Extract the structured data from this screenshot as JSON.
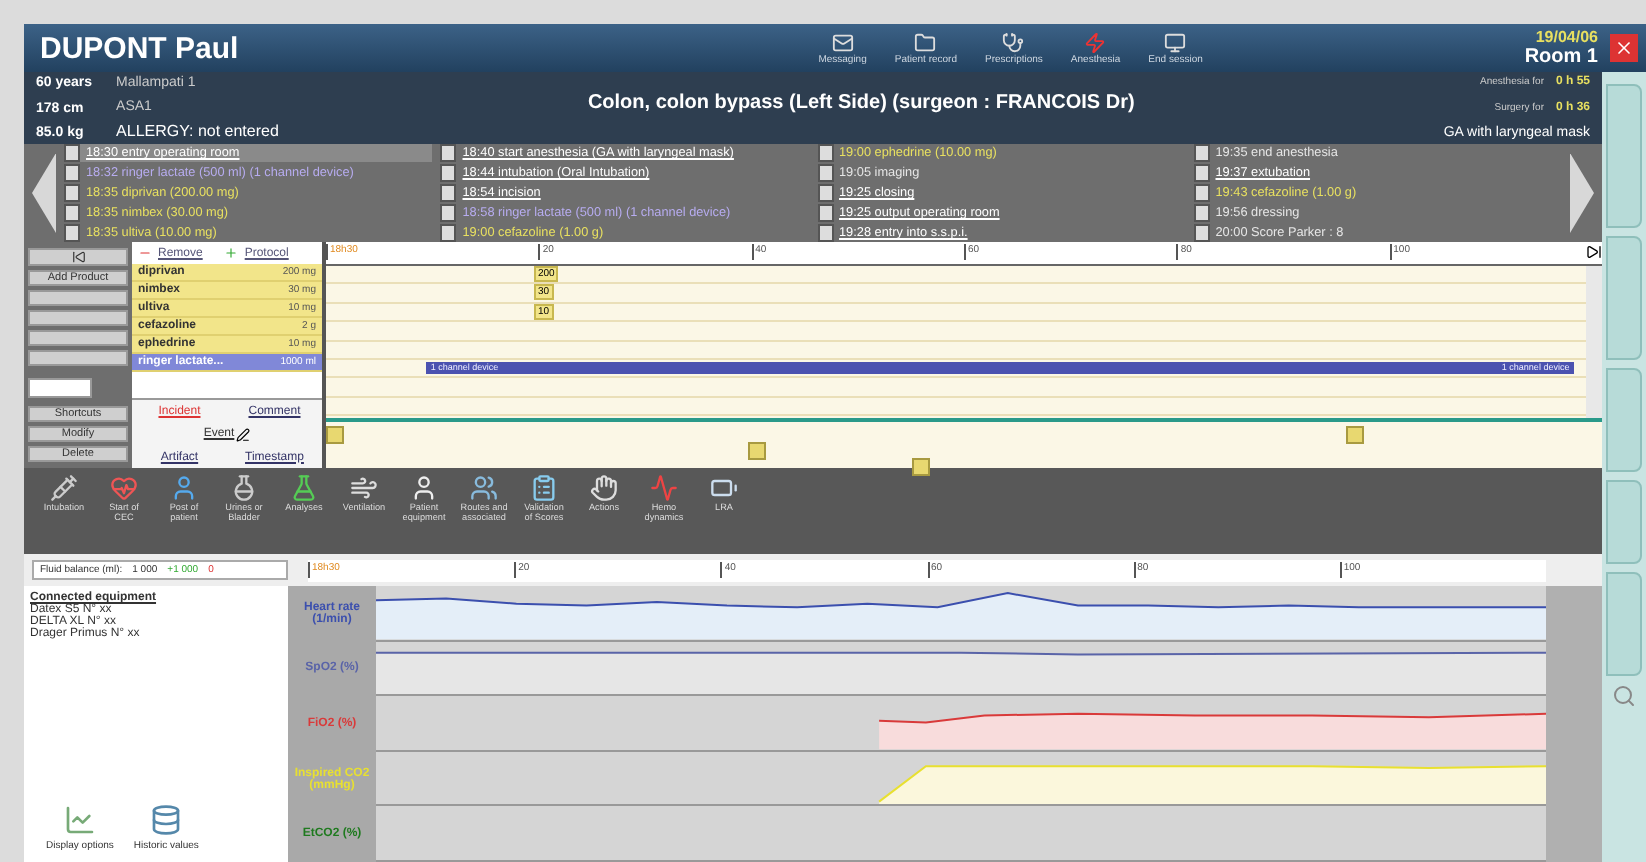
{
  "header": {
    "patient_name": "DUPONT Paul",
    "toolbar": [
      {
        "label": "Messaging"
      },
      {
        "label": "Patient record"
      },
      {
        "label": "Prescriptions"
      },
      {
        "label": "Anesthesia"
      },
      {
        "label": "End session"
      }
    ],
    "date": "19/04/06",
    "room": "Room 1"
  },
  "info": {
    "age": "60 years",
    "height": "178 cm",
    "weight": "85.0 kg",
    "mallampati": "Mallampati 1",
    "asa": "ASA1",
    "allergy": "ALLERGY: not entered",
    "procedure": "Colon, colon bypass (Left Side) (surgeon : FRANCOIS Dr)",
    "durations": [
      {
        "label": "Anesthesia for",
        "value": "0 h 55"
      },
      {
        "label": "Surgery for",
        "value": "0 h 36"
      }
    ],
    "technique": "GA with laryngeal mask"
  },
  "events": [
    [
      {
        "text": "18:30 entry operating room",
        "kind": "milestone",
        "selected": true
      },
      {
        "text": "18:32 ringer lactate (500 ml) (1 channel device)",
        "kind": "infusion",
        "selected": false
      },
      {
        "text": "18:35 diprivan (200.00 mg)",
        "kind": "drug",
        "selected": false
      },
      {
        "text": "18:35 nimbex (30.00 mg)",
        "kind": "drug",
        "selected": false
      },
      {
        "text": "18:35 ultiva (10.00 mg)",
        "kind": "drug",
        "selected": false
      }
    ],
    [
      {
        "text": "18:40 start anesthesia (GA with laryngeal mask)",
        "kind": "milestone",
        "selected": false
      },
      {
        "text": "18:44 intubation (Oral Intubation)",
        "kind": "milestone",
        "selected": false
      },
      {
        "text": "18:54 incision",
        "kind": "milestone",
        "selected": false
      },
      {
        "text": "18:58 ringer lactate (500 ml) (1 channel device)",
        "kind": "infusion",
        "selected": false
      },
      {
        "text": "19:00 cefazoline (1.00 g)",
        "kind": "drug",
        "selected": false
      }
    ],
    [
      {
        "text": "19:00 ephedrine (10.00 mg)",
        "kind": "drug",
        "selected": false
      },
      {
        "text": "19:05 imaging",
        "kind": "note",
        "selected": false
      },
      {
        "text": "19:25 closing",
        "kind": "milestone",
        "selected": false
      },
      {
        "text": "19:25 output operating room",
        "kind": "milestone",
        "selected": false
      },
      {
        "text": "19:28 entry into s.s.p.i.",
        "kind": "milestone",
        "selected": false
      }
    ],
    [
      {
        "text": "19:35 end anesthesia",
        "kind": "note",
        "selected": false
      },
      {
        "text": "19:37 extubation",
        "kind": "milestone",
        "selected": false
      },
      {
        "text": "19:43 cefazoline (1.00 g)",
        "kind": "drug",
        "selected": false
      },
      {
        "text": "19:56 dressing",
        "kind": "note",
        "selected": false
      },
      {
        "text": "20:00 Score Parker : 8",
        "kind": "note",
        "selected": false
      }
    ]
  ],
  "side_buttons": {
    "add": "Add Product",
    "bottom": [
      "Shortcuts",
      "Modify",
      "Delete"
    ]
  },
  "drug_list": {
    "remove": "Remove",
    "protocol": "Protocol",
    "drugs": [
      {
        "name": "diprivan",
        "dose": "200 mg",
        "kind": "bolus",
        "mark": "200",
        "selected": false
      },
      {
        "name": "nimbex",
        "dose": "30 mg",
        "kind": "bolus",
        "mark": "30",
        "selected": false
      },
      {
        "name": "ultiva",
        "dose": "10 mg",
        "kind": "bolus",
        "mark": "10",
        "selected": false
      },
      {
        "name": "cefazoline",
        "dose": "2 g",
        "kind": "bolus",
        "selected": false
      },
      {
        "name": "ephedrine",
        "dose": "10 mg",
        "kind": "bolus",
        "selected": false
      },
      {
        "name": "ringer lactate...",
        "dose": "1000 ml",
        "kind": "infusion",
        "bar_labels": [
          "1 channel device",
          "1 channel device"
        ],
        "selected": true
      }
    ],
    "actions": {
      "incident": "Incident",
      "comment": "Comment",
      "event": "Event",
      "artifact": "Artifact",
      "timestamp": "Timestamp"
    }
  },
  "timeline": {
    "ticks": [
      "18h30",
      "20",
      "40",
      "60",
      "80",
      "100"
    ]
  },
  "care_toolbar": [
    "Intubation",
    "Start of CEC",
    "Post of patient",
    "Urines or Bladder",
    "Analyses",
    "Ventilation",
    "Patient equipment",
    "Routes and associated",
    "Validation of Scores",
    "Actions",
    "Hemo dynamics",
    "LRA"
  ],
  "fluid_balance": {
    "label": "Fluid balance (ml):",
    "total": "1 000",
    "input": "+1 000",
    "output": "0"
  },
  "graph_ruler": {
    "ticks": [
      "18h30",
      "20",
      "40",
      "60",
      "80",
      "100"
    ]
  },
  "equipment": {
    "title": "Connected equipment",
    "devices": [
      "Datex S5 N° xx",
      "DELTA XL N° xx",
      "Drager Primus N° xx"
    ],
    "buttons": [
      "Display options",
      "Historic values"
    ]
  },
  "graphs": [
    {
      "label": "Heart rate (1/min)",
      "color": "#3b4fae"
    },
    {
      "label": "SpO2 (%)",
      "color": "#5a64a8"
    },
    {
      "label": "FiO2 (%)",
      "color": "#d93a3a"
    },
    {
      "label": "Inspired CO2 (mmHg)",
      "color": "#e8e030"
    },
    {
      "label": "EtCO2 (%)",
      "color": "#1f7a1f"
    }
  ]
}
